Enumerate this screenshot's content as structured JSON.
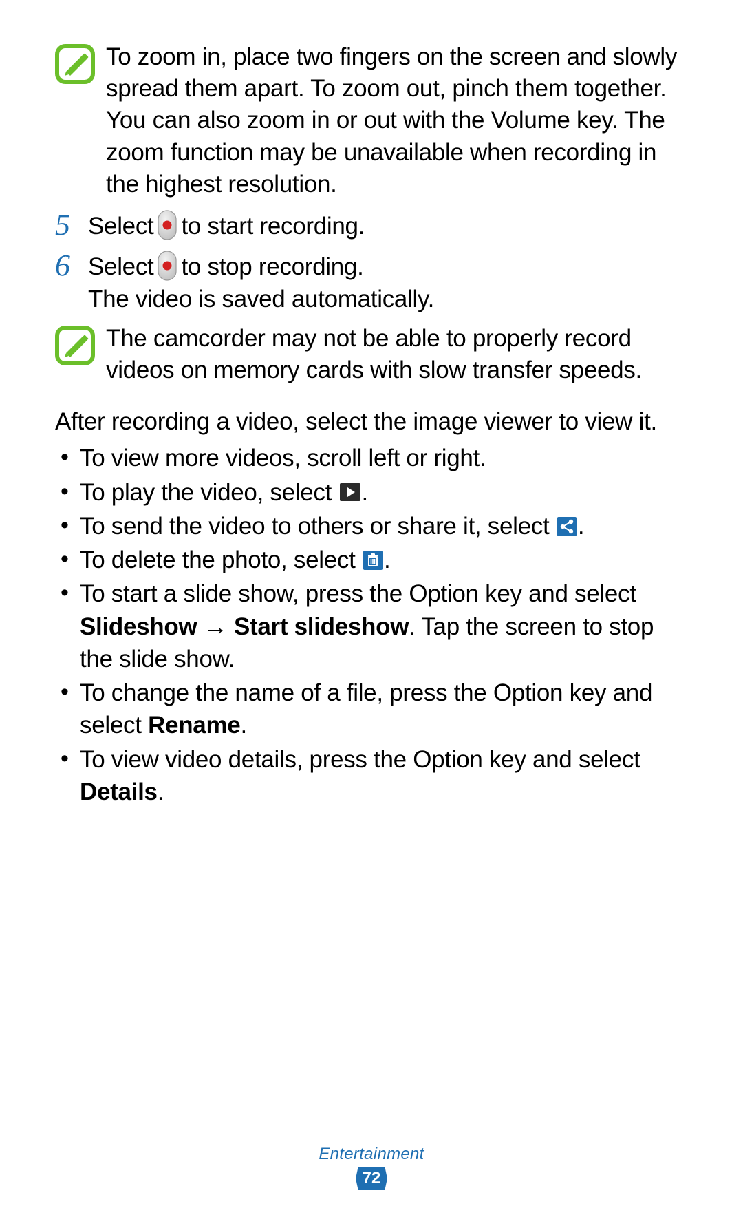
{
  "note1": "To zoom in, place two fingers on the screen and slowly spread them apart. To zoom out, pinch them together. You can also zoom in or out with the Volume key. The zoom function may be unavailable when recording in the highest resolution.",
  "step5": {
    "num": "5",
    "before": "Select",
    "after": "to start recording."
  },
  "step6": {
    "num": "6",
    "before": "Select",
    "after": "to stop recording.",
    "line2": "The video is saved automatically."
  },
  "note2": "The camcorder may not be able to properly record videos on memory cards with slow transfer speeds.",
  "para": "After recording a video, select the image viewer to view it.",
  "bullets": {
    "b1": "To view more videos, scroll left or right.",
    "b2": {
      "before": "To play the video, select",
      "after": "."
    },
    "b3": {
      "before": "To send the video to others or share it, select",
      "after": "."
    },
    "b4": {
      "before": "To delete the photo, select",
      "after": "."
    },
    "b5": {
      "t1": "To start a slide show, press the Option key and select ",
      "bold1": "Slideshow",
      "arrow": " → ",
      "bold2": "Start slideshow",
      "t2": ". Tap the screen to stop the slide show."
    },
    "b6": {
      "t1": "To change the name of a file, press the Option key and select ",
      "bold": "Rename",
      "t2": "."
    },
    "b7": {
      "t1": "To view video details, press the Option key and select ",
      "bold": "Details",
      "t2": "."
    }
  },
  "footer": {
    "category": "Entertainment",
    "page": "72"
  }
}
